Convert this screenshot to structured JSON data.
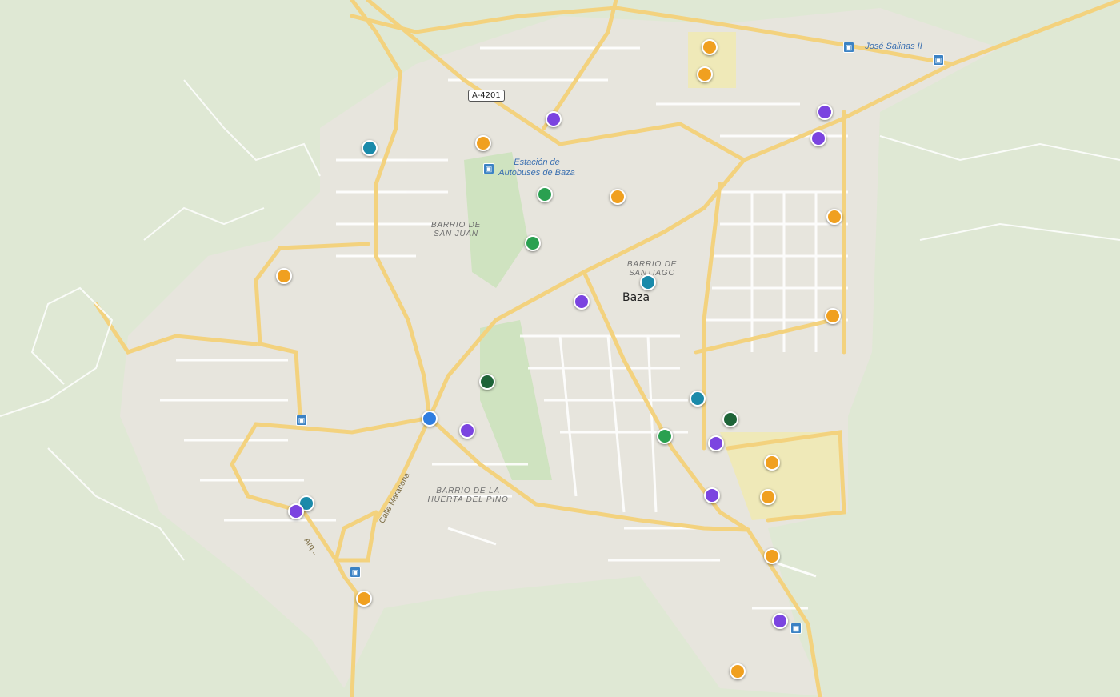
{
  "map": {
    "city_label": "Baza",
    "road_shield": "A-4201",
    "poi": {
      "bus_station": "Estación de Autobuses de Baza",
      "jose_salinas": "José Salinas II"
    },
    "neighborhoods": {
      "san_juan": "BARRIO DE SAN JUAN",
      "santiago": "BARRIO DE SANTIAGO",
      "huerta_pino": "BARRIO DE LA HUERTA DEL PINO"
    },
    "streets": {
      "maracona": "Calle Maracona",
      "arquet": "Arq..."
    }
  },
  "colors": {
    "orange": "#f0a020",
    "purple": "#7b44e0",
    "teal": "#1a8aaa",
    "green": "#2aa050",
    "dark_green": "#1e6438",
    "blue": "#2f7de0"
  },
  "markers": [
    {
      "id": "m1",
      "category": "orange"
    },
    {
      "id": "m2",
      "category": "orange"
    },
    {
      "id": "m3",
      "category": "purple"
    },
    {
      "id": "m4",
      "category": "purple"
    },
    {
      "id": "m5",
      "category": "purple"
    },
    {
      "id": "m6",
      "category": "teal"
    },
    {
      "id": "m7",
      "category": "orange"
    },
    {
      "id": "m8",
      "category": "green"
    },
    {
      "id": "m9",
      "category": "orange"
    },
    {
      "id": "m10",
      "category": "orange"
    },
    {
      "id": "m11",
      "category": "green"
    },
    {
      "id": "m12",
      "category": "orange"
    },
    {
      "id": "m13",
      "category": "teal"
    },
    {
      "id": "m14",
      "category": "purple"
    },
    {
      "id": "m15",
      "category": "orange"
    },
    {
      "id": "m16",
      "category": "dark_green"
    },
    {
      "id": "m17",
      "category": "blue"
    },
    {
      "id": "m18",
      "category": "purple"
    },
    {
      "id": "m19",
      "category": "teal"
    },
    {
      "id": "m20",
      "category": "dark_green"
    },
    {
      "id": "m21",
      "category": "green"
    },
    {
      "id": "m22",
      "category": "purple"
    },
    {
      "id": "m23",
      "category": "orange"
    },
    {
      "id": "m24",
      "category": "orange"
    },
    {
      "id": "m25",
      "category": "purple"
    },
    {
      "id": "m26",
      "category": "teal"
    },
    {
      "id": "m27",
      "category": "purple"
    },
    {
      "id": "m28",
      "category": "orange"
    },
    {
      "id": "m29",
      "category": "orange"
    },
    {
      "id": "m30",
      "category": "purple"
    },
    {
      "id": "m31",
      "category": "orange"
    }
  ]
}
